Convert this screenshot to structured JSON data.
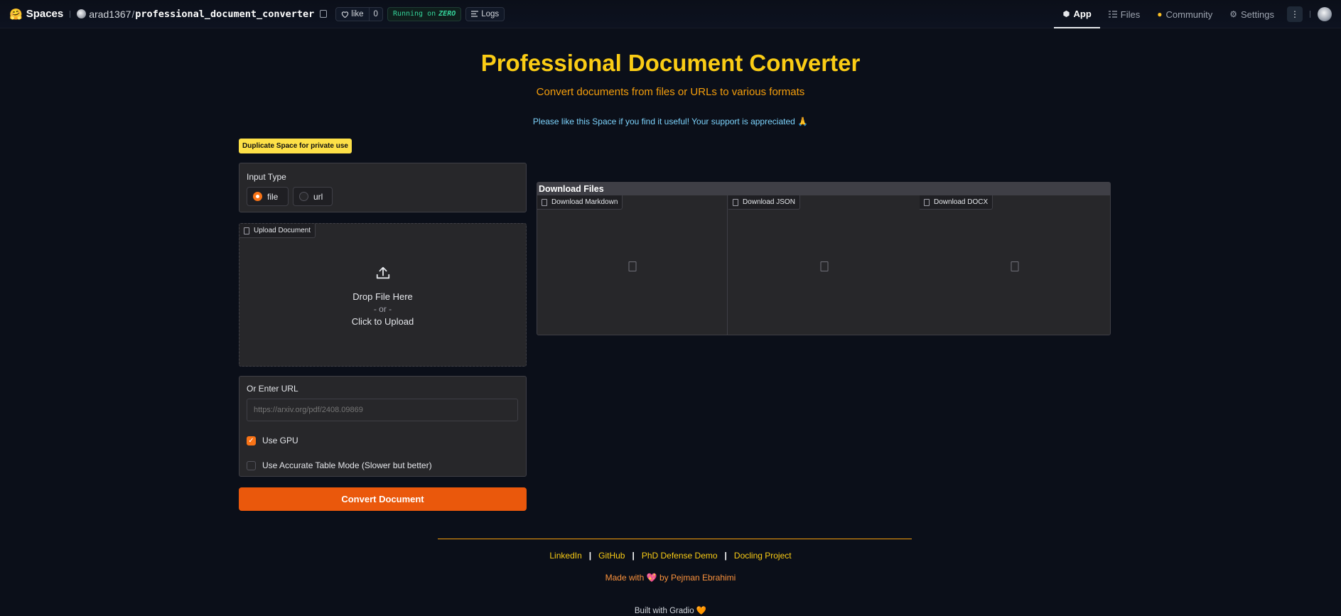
{
  "topbar": {
    "brand": "Spaces",
    "owner": "arad1367",
    "repo": "professional_document_converter",
    "like_label": "like",
    "like_count": "0",
    "running_prefix": "Running on",
    "running_hw": "ZERO",
    "logs_label": "Logs",
    "nav": [
      {
        "label": "App",
        "icon": "cube-icon"
      },
      {
        "label": "Files",
        "icon": "files-icon"
      },
      {
        "label": "Community",
        "icon": "community-icon"
      },
      {
        "label": "Settings",
        "icon": "gear-icon"
      }
    ],
    "more": "⋮"
  },
  "header": {
    "title": "Professional Document Converter",
    "subtitle": "Convert documents from files or URLs to various formats",
    "support": "Please like this Space if you find it useful! Your support is appreciated 🙏"
  },
  "duplicate_badge": "Duplicate Space for private use",
  "input_type": {
    "label": "Input Type",
    "options": [
      "file",
      "url"
    ],
    "selected": "file"
  },
  "upload": {
    "tag": "Upload Document",
    "line1": "Drop File Here",
    "line2": "- or -",
    "line3": "Click to Upload"
  },
  "url_section": {
    "label": "Or Enter URL",
    "placeholder": "https://arxiv.org/pdf/2408.09869",
    "use_gpu": "Use GPU",
    "use_gpu_checked": true,
    "accurate_table": "Use Accurate Table Mode (Slower but better)",
    "accurate_table_checked": false
  },
  "convert_label": "Convert Document",
  "downloads": {
    "header": "Download Files",
    "items": [
      "Download Markdown",
      "Download JSON",
      "Download DOCX"
    ]
  },
  "footer": {
    "links": [
      "LinkedIn",
      "GitHub",
      "PhD Defense Demo",
      "Docling Project"
    ],
    "separator": "|",
    "made_prefix": "Made with",
    "made_heart": "💖",
    "made_suffix": "by Pejman Ebrahimi",
    "built": "Built with Gradio 🧡"
  },
  "colors": {
    "accent": "#ea580c",
    "title": "#facc15",
    "background": "#0b0f19"
  }
}
